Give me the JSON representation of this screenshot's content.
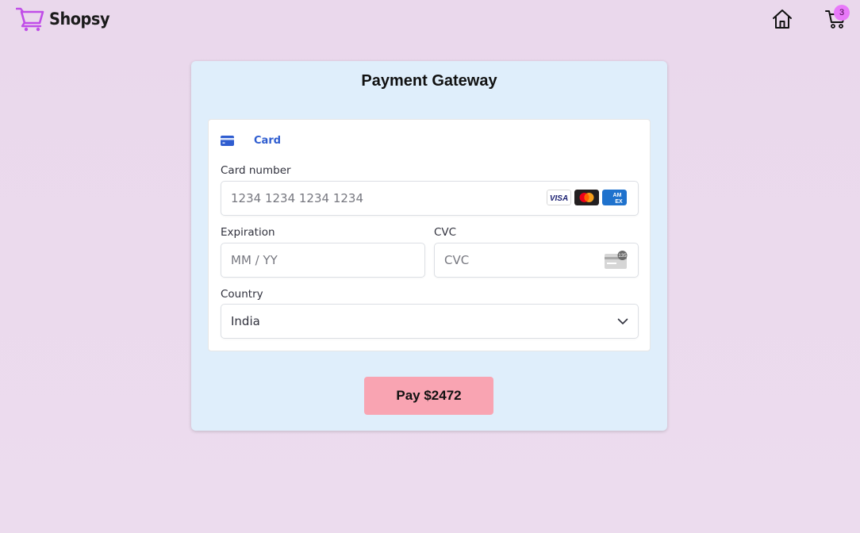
{
  "header": {
    "brand_name": "Shopsy",
    "cart_count": "3",
    "brand_color": "#c04de8",
    "badge_color": "#e879f9"
  },
  "payment": {
    "title": "Payment Gateway",
    "method_tab_label": "Card",
    "card_number": {
      "label": "Card number",
      "placeholder": "1234 1234 1234 1234",
      "brands": [
        "visa-icon",
        "mastercard-icon",
        "amex-icon"
      ]
    },
    "expiration": {
      "label": "Expiration",
      "placeholder": "MM / YY"
    },
    "cvc": {
      "label": "CVC",
      "placeholder": "CVC",
      "hint_number": "135"
    },
    "country": {
      "label": "Country",
      "selected": "India"
    },
    "pay_button_label": "Pay $2472",
    "pay_button_color": "#f9a4b2",
    "accent_color": "#2f5dd0"
  },
  "icons": {
    "logo": "shopping-cart-icon",
    "home": "home-icon",
    "cart": "cart-icon",
    "card_tab": "credit-card-icon",
    "cvc": "cvc-card-icon",
    "chevron": "chevron-down-icon"
  }
}
